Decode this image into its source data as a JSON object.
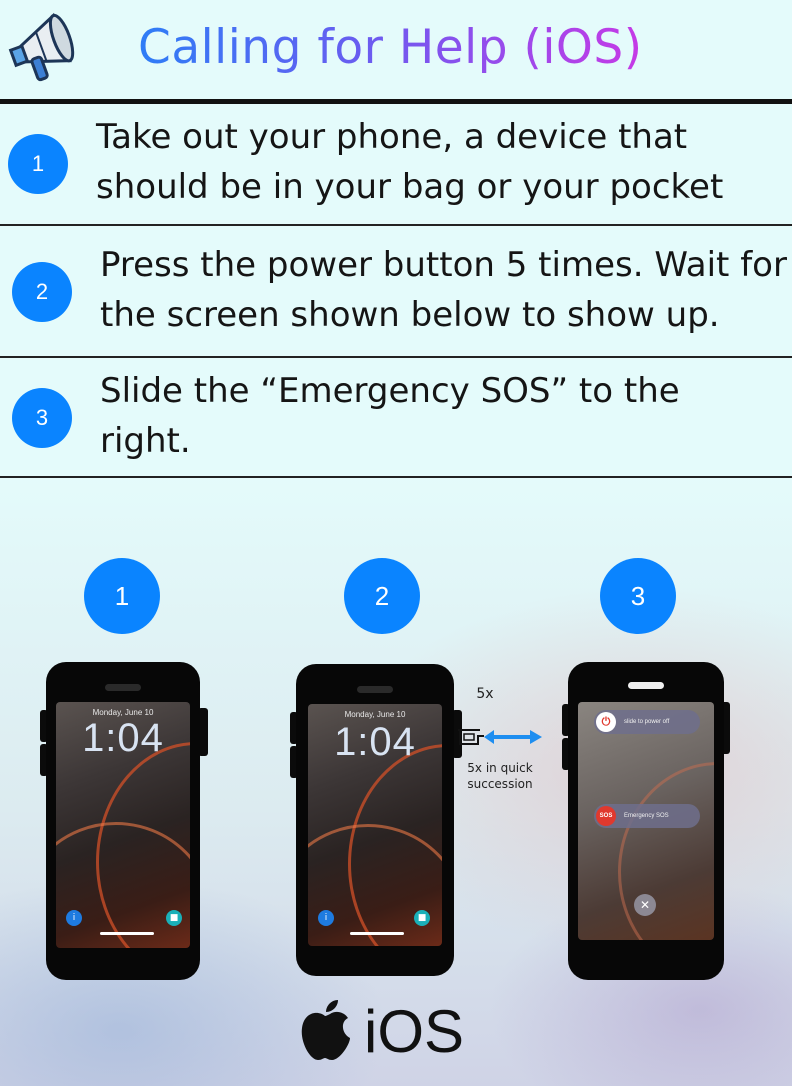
{
  "header": {
    "title": "Calling for Help (iOS)",
    "icon": "megaphone-icon"
  },
  "steps": [
    {
      "number": "1",
      "text_line1": "Take out your phone, a device that",
      "text_line2": "should be in your bag or your pocket"
    },
    {
      "number": "2",
      "text_line1": "Press the power button 5 times. Wait for",
      "text_line2": "the screen shown below to show up."
    },
    {
      "number": "3",
      "text_line1": "Slide the “Emergency SOS” to the",
      "text_line2": "right."
    }
  ],
  "illustration": {
    "circles": [
      "1",
      "2",
      "3"
    ],
    "phone1": {
      "date": "Monday, June 10",
      "time": "1:04"
    },
    "phone2": {
      "date": "Monday, June 10",
      "time": "1:04"
    },
    "phone3": {
      "power_label": "slide to power off",
      "sos_knob": "SOS",
      "sos_label": "Emergency SOS",
      "cancel_icon": "close-icon"
    },
    "annotation_top": "5x",
    "annotation_bottom_line1": "5x in quick",
    "annotation_bottom_line2": "succession"
  },
  "footer": {
    "logo_text": "iOS",
    "logo_icon": "apple-icon"
  },
  "colors": {
    "accent_blue": "#0a84ff",
    "title_start": "#2e7df6",
    "title_end": "#c63ae6",
    "sos_red": "#e0392e"
  }
}
